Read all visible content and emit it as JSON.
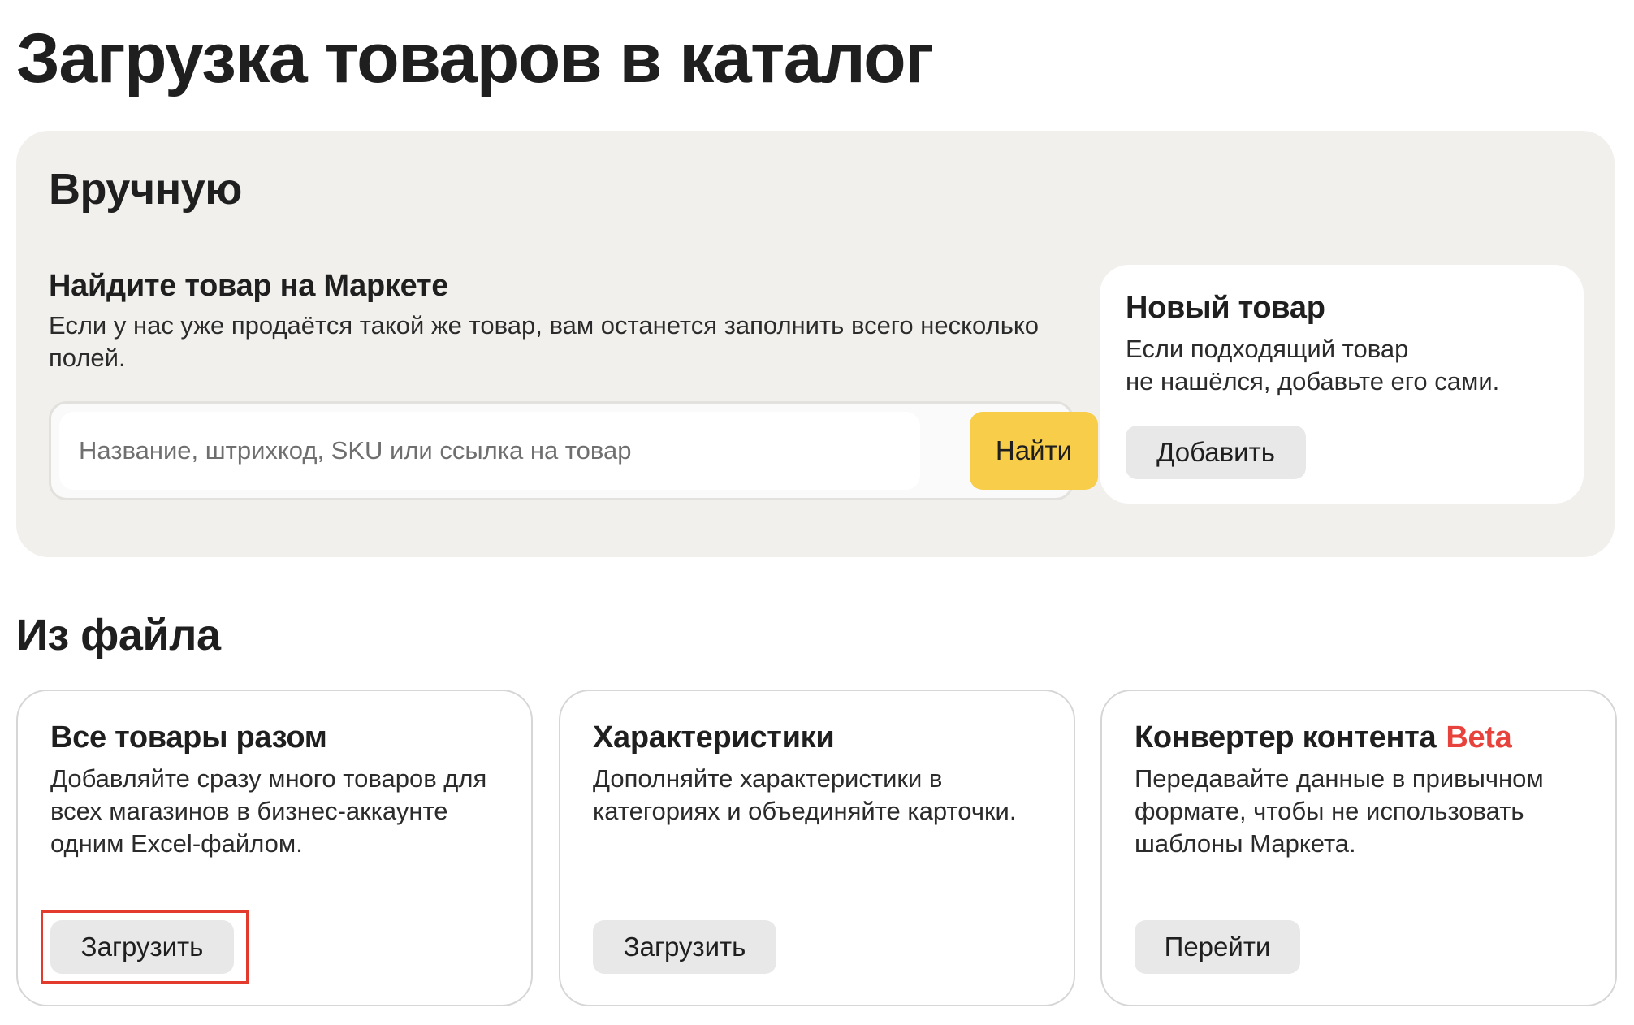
{
  "page": {
    "title": "Загрузка товаров в каталог"
  },
  "manual": {
    "title": "Вручную",
    "find": {
      "title": "Найдите товар на Маркете",
      "description": "Если у нас уже продаётся такой же товар, вам останется заполнить всего несколько полей.",
      "search_placeholder": "Название, штрихкод, SKU или ссылка на товар",
      "search_value": "",
      "button_label": "Найти"
    },
    "new_product": {
      "title": "Новый товар",
      "description_line1": "Если подходящий товар",
      "description_line2": "не нашёлся, добавьте его сами.",
      "button_label": "Добавить"
    }
  },
  "from_file": {
    "title": "Из файла",
    "cards": [
      {
        "title": "Все товары разом",
        "description": "Добавляйте сразу много товаров для всех магазинов в бизнес-аккаунте одним Excel-файлом.",
        "button_label": "Загрузить",
        "highlighted": true
      },
      {
        "title": "Характеристики",
        "description": "Дополняйте характеристики в категориях и объединяйте карточки.",
        "button_label": "Загрузить"
      },
      {
        "title": "Конвертер контента",
        "badge": "Beta",
        "description": "Передавайте данные в привычном формате, чтобы не использовать шаблоны Маркета.",
        "button_label": "Перейти"
      }
    ]
  },
  "colors": {
    "accent_yellow": "#f7cd4a",
    "panel_bg": "#f1f0ed",
    "beta_red": "#e8423c",
    "highlight_red": "#e23b2e"
  }
}
